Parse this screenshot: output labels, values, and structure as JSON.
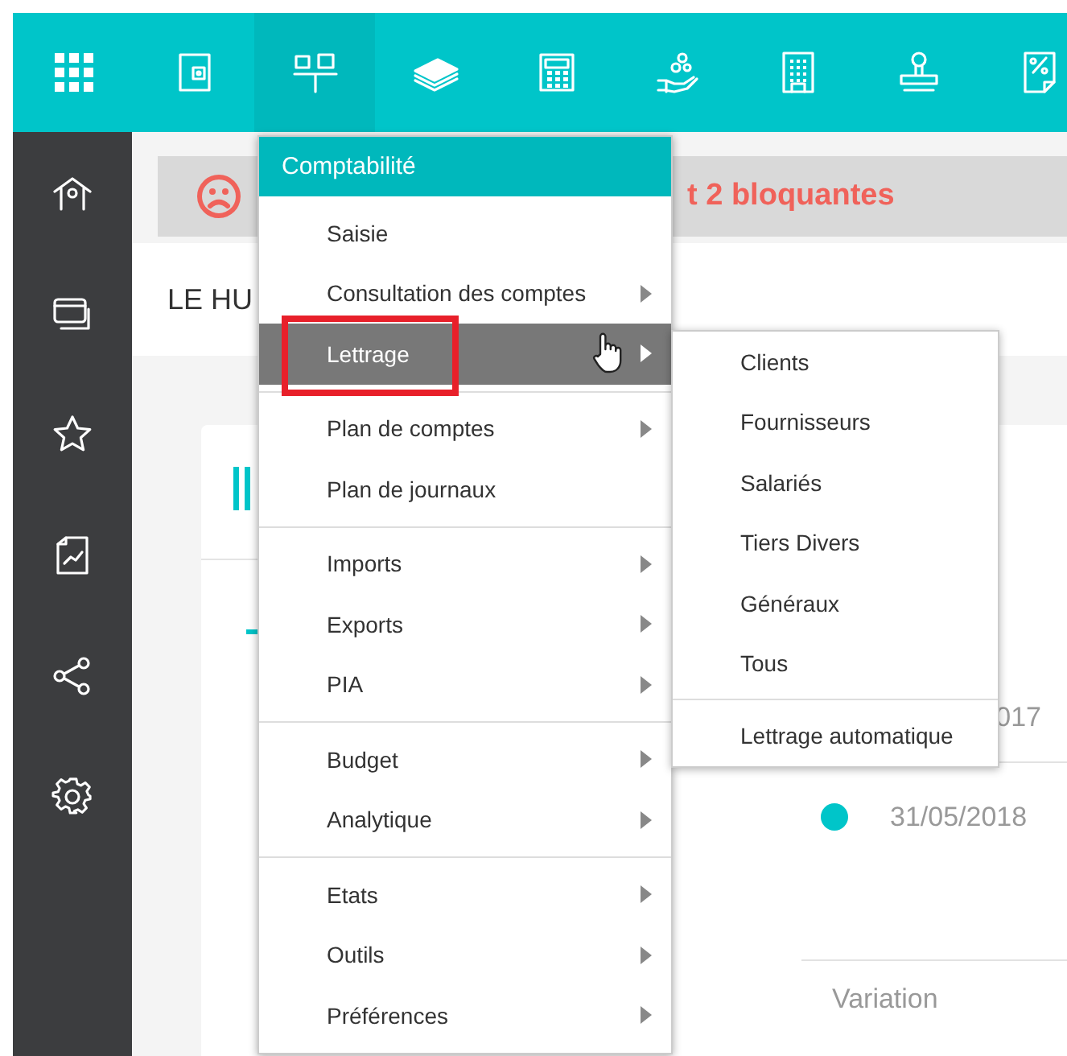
{
  "toolbar": [
    {
      "selected": false
    },
    {
      "selected": false
    },
    {
      "selected": true
    },
    {
      "selected": false
    },
    {
      "selected": false
    },
    {
      "selected": false
    },
    {
      "selected": false
    },
    {
      "selected": false
    },
    {
      "selected": false
    }
  ],
  "alert": {
    "text": "t 2 bloquantes"
  },
  "page_header": {
    "title": "LE HU"
  },
  "timeline": {
    "year_fragment": "017",
    "date": "31/05/2018",
    "label": "Variation"
  },
  "menu": {
    "title": "Comptabilité",
    "sections": [
      {
        "items": [
          {
            "label": "Saisie",
            "has_submenu": false,
            "selected": false,
            "annotated": false
          },
          {
            "label": "Consultation des comptes",
            "has_submenu": true,
            "selected": false,
            "annotated": false
          },
          {
            "label": "Lettrage",
            "has_submenu": true,
            "selected": true,
            "annotated": true
          }
        ]
      },
      {
        "items": [
          {
            "label": "Plan de comptes",
            "has_submenu": true,
            "selected": false,
            "annotated": false
          },
          {
            "label": "Plan de journaux",
            "has_submenu": false,
            "selected": false,
            "annotated": false
          }
        ]
      },
      {
        "items": [
          {
            "label": "Imports",
            "has_submenu": true,
            "selected": false,
            "annotated": false
          },
          {
            "label": "Exports",
            "has_submenu": true,
            "selected": false,
            "annotated": false
          },
          {
            "label": "PIA",
            "has_submenu": true,
            "selected": false,
            "annotated": false
          }
        ]
      },
      {
        "items": [
          {
            "label": "Budget",
            "has_submenu": true,
            "selected": false,
            "annotated": false
          },
          {
            "label": "Analytique",
            "has_submenu": true,
            "selected": false,
            "annotated": false
          }
        ]
      },
      {
        "items": [
          {
            "label": "Etats",
            "has_submenu": true,
            "selected": false,
            "annotated": false
          },
          {
            "label": "Outils",
            "has_submenu": true,
            "selected": false,
            "annotated": false
          },
          {
            "label": "Préférences",
            "has_submenu": true,
            "selected": false,
            "annotated": false
          }
        ]
      }
    ]
  },
  "submenu": {
    "sections": [
      {
        "items": [
          {
            "label": "Clients"
          },
          {
            "label": "Fournisseurs"
          },
          {
            "label": "Salariés"
          },
          {
            "label": "Tiers Divers"
          },
          {
            "label": "Généraux"
          },
          {
            "label": "Tous"
          }
        ]
      },
      {
        "items": [
          {
            "label": "Lettrage automatique"
          }
        ]
      }
    ]
  }
}
